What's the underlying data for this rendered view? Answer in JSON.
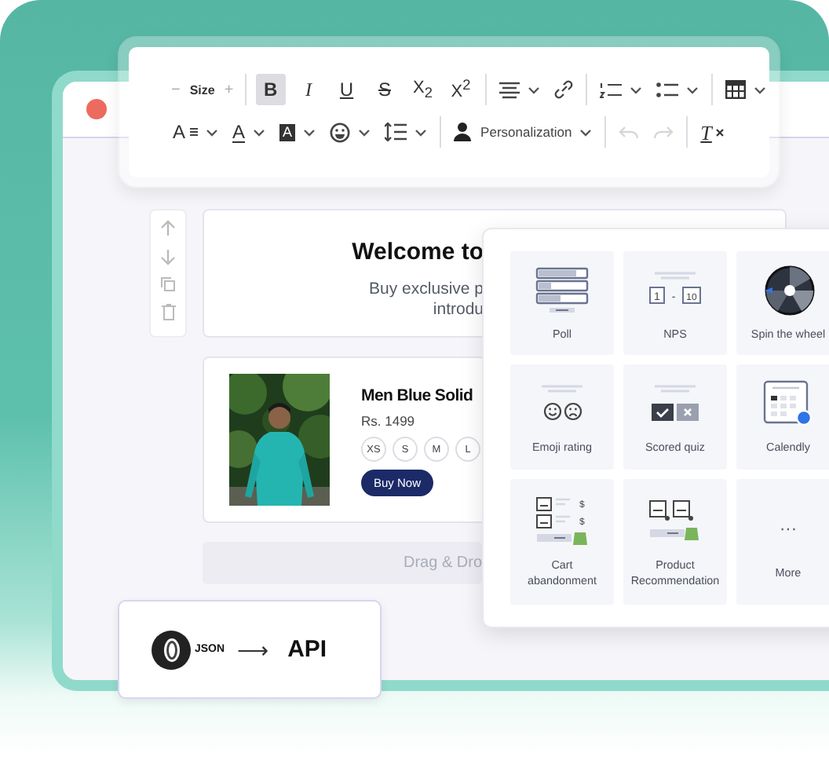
{
  "toolbar": {
    "rows": [
      [
        {
          "kind": "decrease",
          "label": "−"
        },
        {
          "kind": "label",
          "label": "Size"
        },
        {
          "kind": "increase",
          "label": "+"
        },
        {
          "kind": "divider"
        },
        {
          "kind": "bold",
          "label": "B",
          "selected": true
        },
        {
          "kind": "italic",
          "label": "I",
          "selected": false
        },
        {
          "kind": "underline",
          "label": "U",
          "selected": false
        },
        {
          "kind": "strike",
          "label": "S",
          "selected": false
        },
        {
          "kind": "subscript",
          "label": "X$_{2}$",
          "selected": false
        },
        {
          "kind": "superscript",
          "label": "X$^{2}$",
          "selected": false
        },
        {
          "kind": "divider"
        },
        {
          "kind": "align",
          "dropdown": true
        },
        {
          "kind": "link",
          "dropdown": false
        },
        {
          "kind": "divider"
        },
        {
          "kind": "numbered-list",
          "dropdown": true
        },
        {
          "kind": "bullet-list",
          "dropdown": true
        },
        {
          "kind": "divider"
        },
        {
          "kind": "table",
          "dropdown": true
        }
      ],
      [
        {
          "kind": "font-size",
          "label": "A",
          "dropdown": true
        },
        {
          "kind": "text-color",
          "label": "A",
          "dropdown": true
        },
        {
          "kind": "highlight",
          "label": "A",
          "dropdown": true
        },
        {
          "kind": "emoji",
          "dropdown": true
        },
        {
          "kind": "line-height",
          "dropdown": true
        },
        {
          "kind": "divider"
        },
        {
          "kind": "personalization",
          "label": "Personalization",
          "dropdown": true
        },
        {
          "kind": "divider"
        },
        {
          "kind": "undo",
          "disabled": true
        },
        {
          "kind": "redo",
          "disabled": true
        },
        {
          "kind": "divider"
        },
        {
          "kind": "clear-format",
          "label": "T",
          "disabled": false
        }
      ]
    ]
  },
  "block_tools": [
    {
      "kind": "up"
    },
    {
      "kind": "down"
    },
    {
      "kind": "copy"
    },
    {
      "kind": "delete"
    }
  ],
  "welcome": {
    "heading": "Welcome to",
    "lines": [
      "Buy exclusive p",
      "introdu"
    ]
  },
  "product": {
    "name": "Men Blue Solid",
    "price": "Rs. 1499",
    "sizes": [
      "XS",
      "S",
      "M",
      "L"
    ],
    "button": "Buy Now"
  },
  "dropzone": {
    "text": "Drag & Dro"
  },
  "widgets": [
    {
      "kind": "poll",
      "label": "Poll"
    },
    {
      "kind": "nps",
      "label": "NPS",
      "scale": [
        "1",
        "-",
        "10"
      ]
    },
    {
      "kind": "wheel",
      "label": "Spin the wheel"
    },
    {
      "kind": "emoji",
      "label": "Emoji rating"
    },
    {
      "kind": "quiz",
      "label": "Scored quiz"
    },
    {
      "kind": "calendar",
      "label": "Calendly"
    },
    {
      "kind": "cart",
      "label": "Cart abandonment",
      "prices": [
        "$",
        "$"
      ]
    },
    {
      "kind": "product",
      "label": "Product Recommendation"
    },
    {
      "kind": "more",
      "label": "More",
      "symbol": "···"
    }
  ],
  "api_card": {
    "source": "JSON",
    "arrow": "⟶",
    "target": "API"
  }
}
